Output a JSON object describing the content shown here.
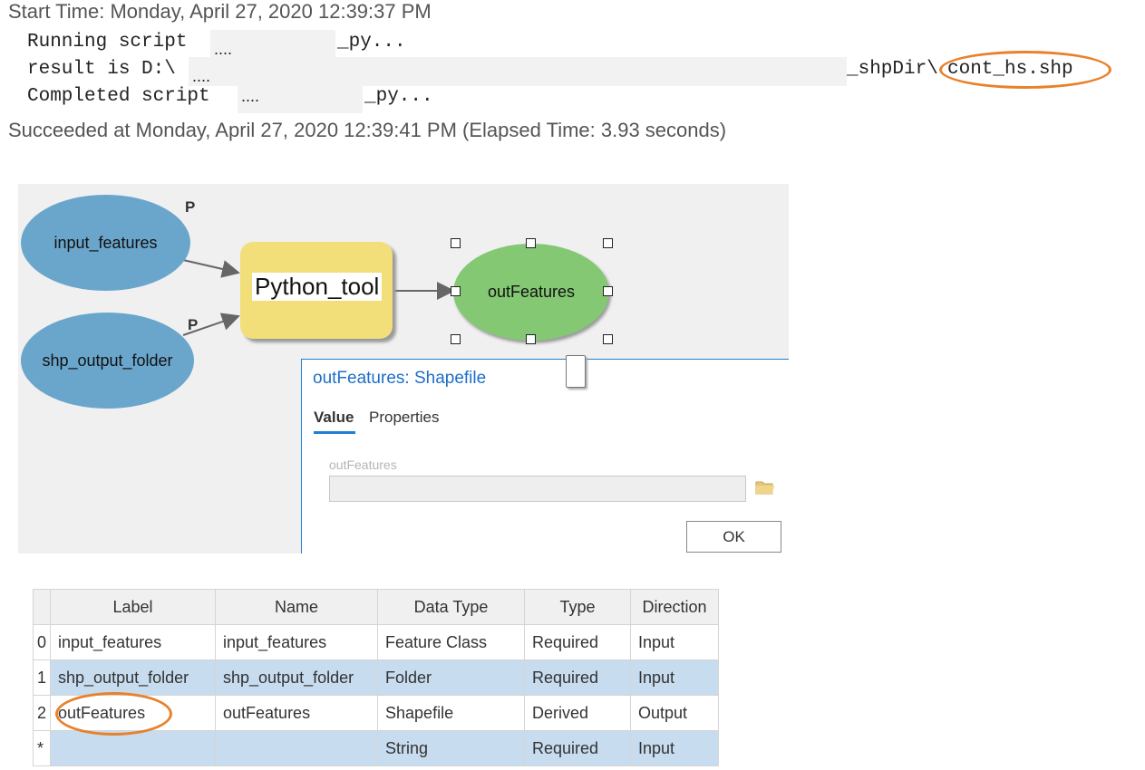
{
  "log": {
    "start_line": "Start Time: Monday, April 27, 2020 12:39:37 PM",
    "running_prefix": "Running script",
    "running_suffix": "_py...",
    "result_prefix": "result is D:\\",
    "result_mid": "_shpDir\\",
    "result_file": "cont_hs.shp",
    "completed_prefix": "Completed script",
    "completed_suffix": "_py...",
    "redacted_marker": "....",
    "succeeded_line": "Succeeded at Monday, April 27, 2020 12:39:41 PM (Elapsed Time: 3.93 seconds)"
  },
  "model": {
    "input_features_label": "input_features",
    "shp_output_folder_label": "shp_output_folder",
    "tool_label": "Python_tool",
    "out_features_label": "outFeatures",
    "parameter_mark": "P"
  },
  "dialog": {
    "title": "outFeatures: Shapefile",
    "close_glyph": "×",
    "tabs": [
      "Value",
      "Properties"
    ],
    "field_label": "outFeatures",
    "field_value": "",
    "ok_label": "OK"
  },
  "table": {
    "headers": [
      "Label",
      "Name",
      "Data Type",
      "Type",
      "Direction"
    ],
    "rows": [
      {
        "idx": "0",
        "label": "input_features",
        "name": "input_features",
        "data_type": "Feature Class",
        "type": "Required",
        "direction": "Input"
      },
      {
        "idx": "1",
        "label": "shp_output_folder",
        "name": "shp_output_folder",
        "data_type": "Folder",
        "type": "Required",
        "direction": "Input"
      },
      {
        "idx": "2",
        "label": "outFeatures",
        "name": "outFeatures",
        "data_type": "Shapefile",
        "type": "Derived",
        "direction": "Output"
      },
      {
        "idx": "*",
        "label": "",
        "name": "",
        "data_type": "String",
        "type": "Required",
        "direction": "Input"
      }
    ]
  },
  "colors": {
    "highlight": "#e8812b",
    "input_node": "#6aa6cc",
    "tool_node": "#f3df7a",
    "output_node": "#84c873",
    "selected_row": "#c7dcee",
    "dialog_accent": "#1e6fc7"
  }
}
